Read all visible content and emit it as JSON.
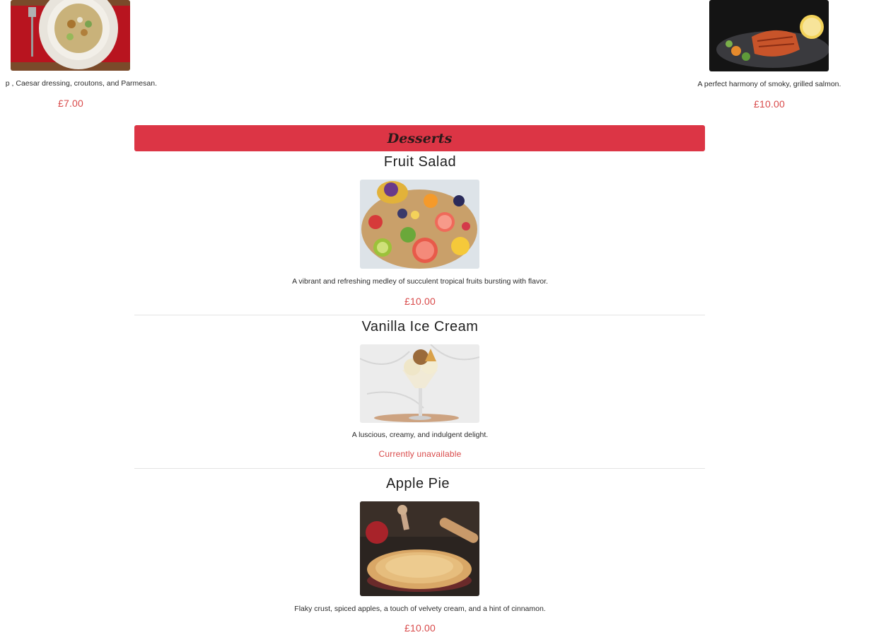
{
  "top_items": [
    {
      "description": "p , Caesar dressing, croutons, and Parmesan.",
      "price": "£7.00",
      "icon": "caesar-salad-image"
    },
    {
      "description": "A perfect harmony of smoky, grilled salmon.",
      "price": "£10.00",
      "icon": "grilled-salmon-image"
    }
  ],
  "section": {
    "title": "Desserts"
  },
  "items": [
    {
      "name": "Fruit Salad",
      "description": "A vibrant and refreshing medley of succulent tropical fruits bursting with flavor.",
      "price": "£10.00",
      "icon": "fruit-salad-image"
    },
    {
      "name": "Vanilla Ice Cream",
      "description": "A luscious, creamy, and indulgent delight.",
      "price": "Currently unavailable",
      "icon": "ice-cream-image"
    },
    {
      "name": "Apple Pie",
      "description": "Flaky crust, spiced apples, a touch of velvety cream, and a hint of cinnamon.",
      "price": "£10.00",
      "icon": "apple-pie-image"
    }
  ],
  "colors": {
    "accent": "#dc3545",
    "price": "#d94a4a"
  }
}
